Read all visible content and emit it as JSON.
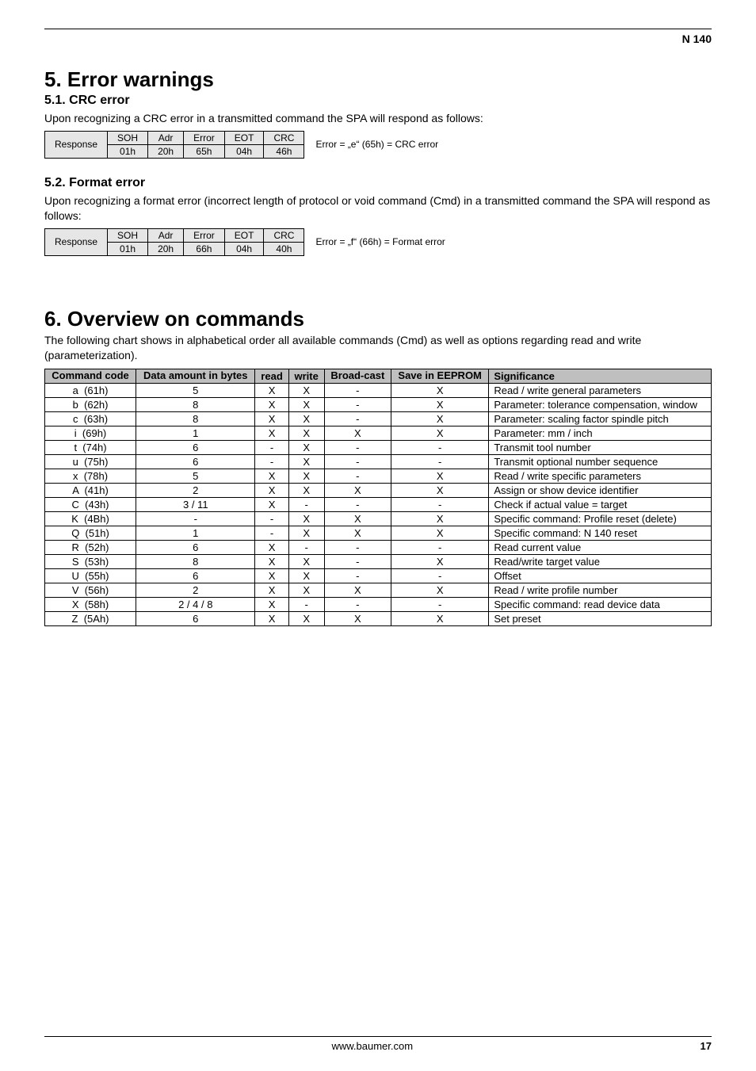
{
  "header": {
    "doc_label": "N 140"
  },
  "s5": {
    "title": "5. Error warnings",
    "s51": {
      "title": "5.1.   CRC error",
      "intro": "Upon recognizing a CRC error in a transmitted command the SPA will respond as follows:",
      "table": {
        "row_label": "Response",
        "cols": [
          "SOH",
          "Adr",
          "Error",
          "EOT",
          "CRC"
        ],
        "vals": [
          "01h",
          "20h",
          "65h",
          "04h",
          "46h"
        ],
        "note": "Error = „e“ (65h)  = CRC error"
      }
    },
    "s52": {
      "title": "5.2.   Format error",
      "intro": "Upon recognizing a format error (incorrect length of protocol or void command (Cmd) in a transmitted command the SPA will respond as follows:",
      "table": {
        "row_label": "Response",
        "cols": [
          "SOH",
          "Adr",
          "Error",
          "EOT",
          "CRC"
        ],
        "vals": [
          "01h",
          "20h",
          "66h",
          "04h",
          "40h"
        ],
        "note": "Error = „f“ (66h)  = Format error"
      }
    }
  },
  "s6": {
    "title": "6. Overview on commands",
    "intro": "The following chart shows in alphabetical order all available commands (Cmd) as well as options regarding read and write (parameterization).",
    "headers": {
      "code": "Command code",
      "amount": "Data amount in bytes",
      "read": "read",
      "write": "write",
      "broadcast": "Broad-cast",
      "save": "Save in EEPROM",
      "sig": "Significance"
    },
    "rows": [
      {
        "code": "a  (61h)",
        "amount": "5",
        "read": "X",
        "write": "X",
        "bc": "-",
        "save": "X",
        "sig": "Read / write general parameters"
      },
      {
        "code": "b  (62h)",
        "amount": "8",
        "read": "X",
        "write": "X",
        "bc": "-",
        "save": "X",
        "sig": "Parameter: tolerance compensation, window"
      },
      {
        "code": "c  (63h)",
        "amount": "8",
        "read": "X",
        "write": "X",
        "bc": "-",
        "save": "X",
        "sig": "Parameter: scaling factor spindle pitch"
      },
      {
        "code": "i  (69h)",
        "amount": "1",
        "read": "X",
        "write": "X",
        "bc": "X",
        "save": "X",
        "sig": "Parameter: mm / inch"
      },
      {
        "code": "t  (74h)",
        "amount": "6",
        "read": "-",
        "write": "X",
        "bc": "-",
        "save": "-",
        "sig": "Transmit tool number"
      },
      {
        "code": "u  (75h)",
        "amount": "6",
        "read": "-",
        "write": "X",
        "bc": "-",
        "save": "-",
        "sig": "Transmit optional number sequence"
      },
      {
        "code": "x  (78h)",
        "amount": "5",
        "read": "X",
        "write": "X",
        "bc": "-",
        "save": "X",
        "sig": "Read / write specific parameters"
      },
      {
        "code": "A  (41h)",
        "amount": "2",
        "read": "X",
        "write": "X",
        "bc": "X",
        "save": "X",
        "sig": "Assign or show device identifier"
      },
      {
        "code": "C  (43h)",
        "amount": "3 / 11",
        "read": "X",
        "write": "-",
        "bc": "-",
        "save": "-",
        "sig": "Check if actual value = target"
      },
      {
        "code": "K  (4Bh)",
        "amount": "-",
        "read": "-",
        "write": "X",
        "bc": "X",
        "save": "X",
        "sig": "Specific command: Profile reset (delete)"
      },
      {
        "code": "Q  (51h)",
        "amount": "1",
        "read": "-",
        "write": "X",
        "bc": "X",
        "save": "X",
        "sig": "Specific command: N 140 reset"
      },
      {
        "code": "R  (52h)",
        "amount": "6",
        "read": "X",
        "write": "-",
        "bc": "-",
        "save": "-",
        "sig": "Read current value"
      },
      {
        "code": "S  (53h)",
        "amount": "8",
        "read": "X",
        "write": "X",
        "bc": "-",
        "save": "X",
        "sig": "Read/write target value"
      },
      {
        "code": "U  (55h)",
        "amount": "6",
        "read": "X",
        "write": "X",
        "bc": "-",
        "save": "-",
        "sig": "Offset"
      },
      {
        "code": "V  (56h)",
        "amount": "2",
        "read": "X",
        "write": "X",
        "bc": "X",
        "save": "X",
        "sig": "Read / write profile number"
      },
      {
        "code": "X  (58h)",
        "amount": "2 / 4 / 8",
        "read": "X",
        "write": "-",
        "bc": "-",
        "save": "-",
        "sig": "Specific command: read device data"
      },
      {
        "code": "Z  (5Ah)",
        "amount": "6",
        "read": "X",
        "write": "X",
        "bc": "X",
        "save": "X",
        "sig": "Set preset"
      }
    ]
  },
  "footer": {
    "site": "www.baumer.com",
    "page": "17"
  }
}
